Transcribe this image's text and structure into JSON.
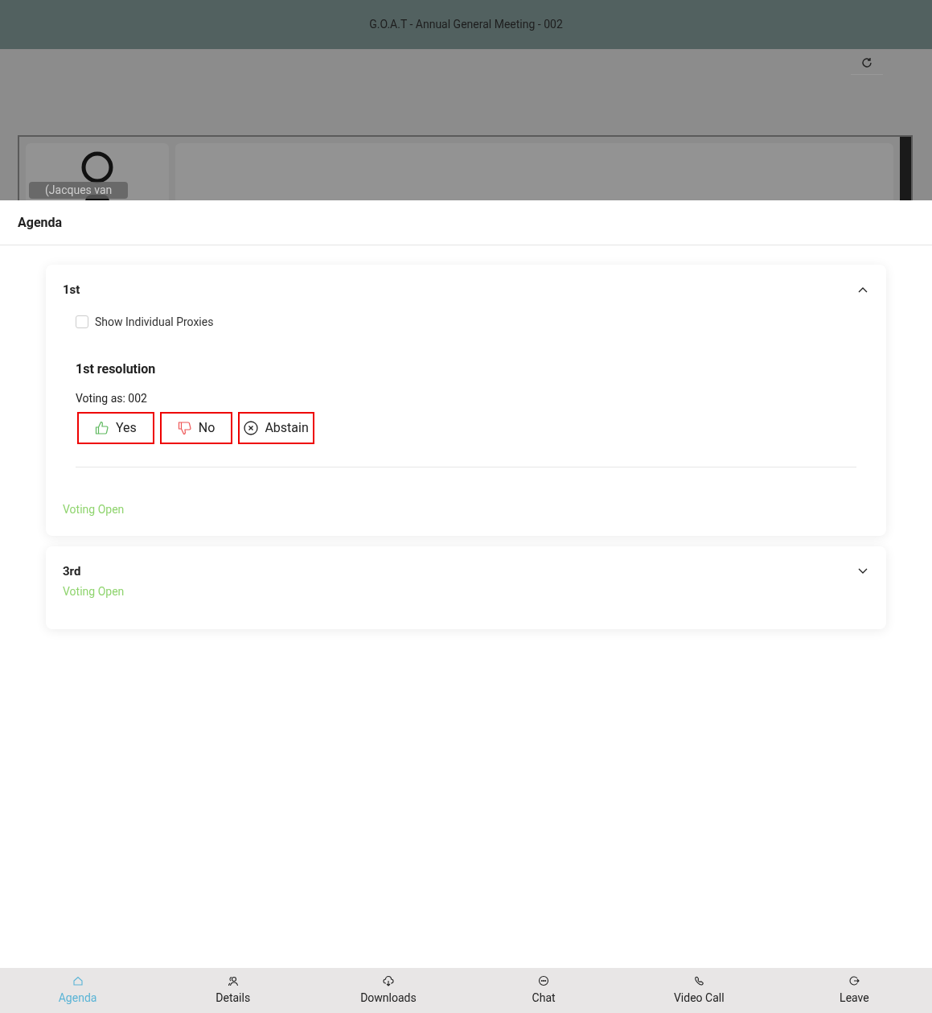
{
  "header": {
    "title": "G.O.A.T - Annual General Meeting - 002"
  },
  "video": {
    "participant_name": "(Jacques van"
  },
  "sheet": {
    "title": "Agenda"
  },
  "agenda_items": [
    {
      "title": "1st",
      "expanded": true,
      "show_proxies": {
        "label": "Show Individual Proxies",
        "checked": false
      },
      "resolutions": [
        {
          "title": "1st resolution",
          "voting_as": "Voting as: 002",
          "options": [
            {
              "kind": "yes",
              "label": "Yes",
              "selected": false
            },
            {
              "kind": "no",
              "label": "No",
              "selected": false
            },
            {
              "kind": "abstain",
              "label": "Abstain",
              "selected": false
            }
          ]
        }
      ],
      "status": "Voting Open"
    },
    {
      "title": "3rd",
      "expanded": false,
      "status": "Voting Open"
    }
  ],
  "nav": [
    {
      "kind": "home",
      "label": "Agenda",
      "selected": true
    },
    {
      "kind": "people",
      "label": "Details",
      "selected": false
    },
    {
      "kind": "cloud",
      "label": "Downloads",
      "selected": false
    },
    {
      "kind": "chat",
      "label": "Chat",
      "selected": false
    },
    {
      "kind": "phone",
      "label": "Video Call",
      "selected": false
    },
    {
      "kind": "leave",
      "label": "Leave",
      "selected": false
    }
  ]
}
